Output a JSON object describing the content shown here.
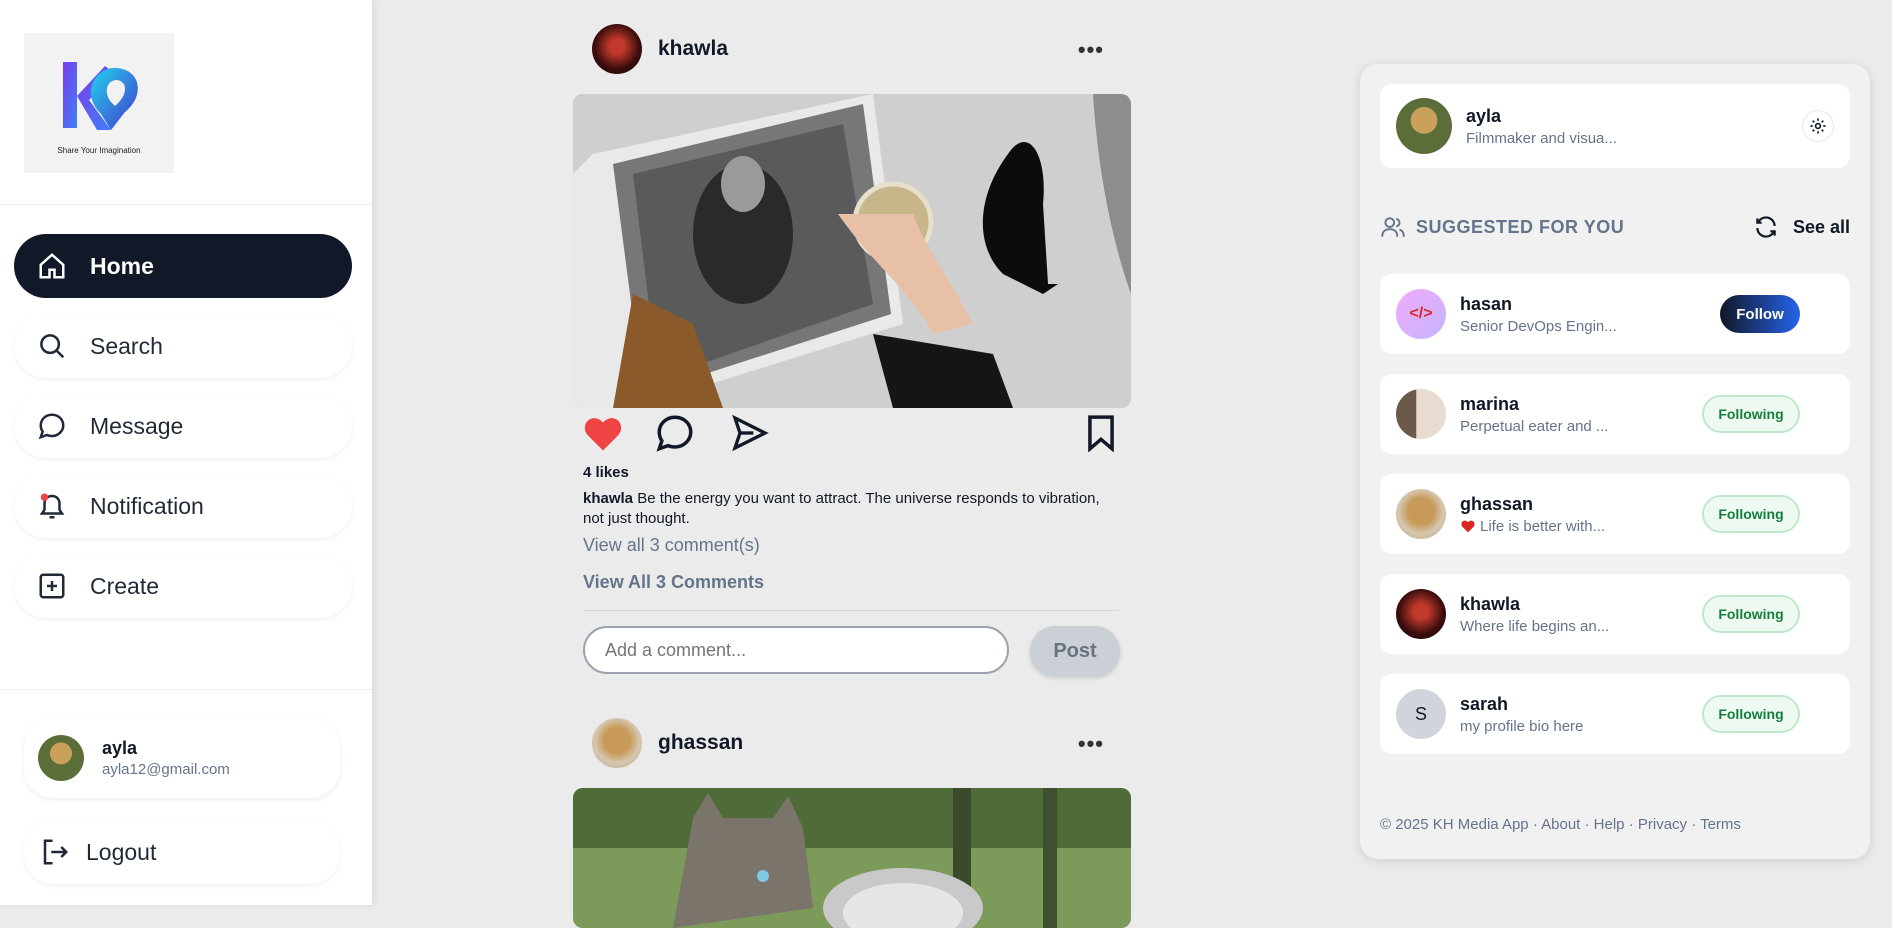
{
  "logo": {
    "tagline": "Share Your Imagination"
  },
  "nav": [
    {
      "label": "Home",
      "icon": "home-icon"
    },
    {
      "label": "Search",
      "icon": "search-icon"
    },
    {
      "label": "Message",
      "icon": "message-icon"
    },
    {
      "label": "Notification",
      "icon": "bell-icon"
    },
    {
      "label": "Create",
      "icon": "plus-square-icon"
    }
  ],
  "current_user": {
    "name": "ayla",
    "email": "ayla12@gmail.com"
  },
  "logout_label": "Logout",
  "posts": [
    {
      "author": "khawla",
      "likes": "4 likes",
      "caption_author": "khawla",
      "caption": "Be the energy you want to attract. The universe responds to vibration, not just thought.",
      "view_comments_light": "View all 3 comment(s)",
      "view_comments_bold": "View All 3 Comments",
      "comment_placeholder": "Add a comment...",
      "post_label": "Post",
      "liked": true
    },
    {
      "author": "ghassan"
    }
  ],
  "right_panel": {
    "profile": {
      "name": "ayla",
      "bio": "Filmmaker and visua..."
    },
    "suggested_title": "SUGGESTED FOR YOU",
    "see_all": "See all",
    "suggestions": [
      {
        "name": "hasan",
        "bio": "Senior DevOps Engin...",
        "action": "Follow"
      },
      {
        "name": "marina",
        "bio": "Perpetual eater and ...",
        "action": "Following"
      },
      {
        "name": "ghassan",
        "bio": "Life is better with...",
        "action": "Following"
      },
      {
        "name": "khawla",
        "bio": "Where life begins an...",
        "action": "Following"
      },
      {
        "name": "sarah",
        "bio": "my profile bio here",
        "action": "Following",
        "initial": "S"
      }
    ],
    "footer": "© 2025 KH Media App · About · Help · Privacy · Terms"
  },
  "colors": {
    "accent": "#111827",
    "like": "#ef4444",
    "following": "#15803d"
  }
}
